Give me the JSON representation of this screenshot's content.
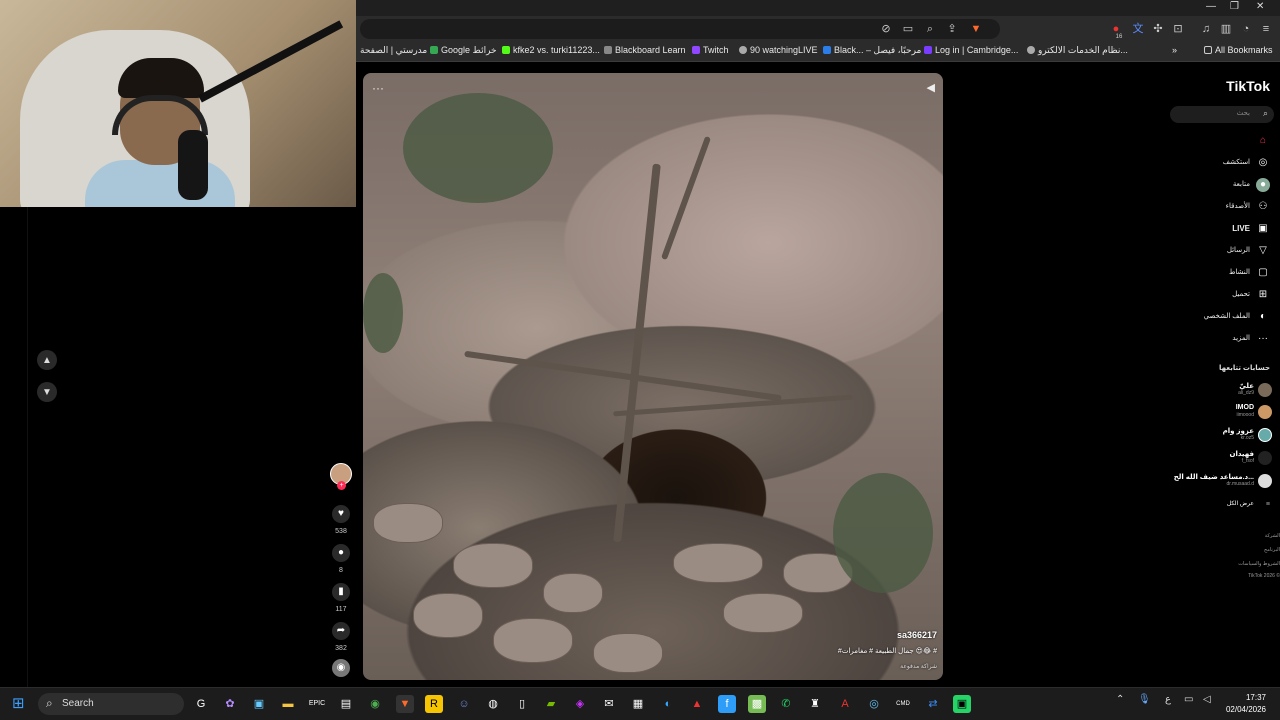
{
  "browser": {
    "bookmarks": [
      "مدرستي | الصفحة",
      "Google خرائط",
      "kfke2 vs. turki11223...",
      "Blackboard Learn",
      "Twitch",
      "90 watchingLIVE",
      "Black... – مرحبًا، فيصل",
      "Log in | Cambridge...",
      "نظام الخدمات الالكترو...",
      "All Bookmarks"
    ],
    "extension_badge": "16"
  },
  "tiktok": {
    "logo": "TikTok",
    "search_placeholder": "بحث",
    "nav": [
      {
        "label": "",
        "icon": "home-icon"
      },
      {
        "label": "استكشف",
        "icon": "compass-icon"
      },
      {
        "label": "متابعة",
        "icon": "following-icon"
      },
      {
        "label": "الأصدقاء",
        "icon": "friends-icon"
      },
      {
        "label": "LIVE",
        "icon": "live-icon"
      },
      {
        "label": "الرسائل",
        "icon": "send-icon"
      },
      {
        "label": "النشاط",
        "icon": "inbox-icon"
      },
      {
        "label": "تحميل",
        "icon": "upload-icon"
      },
      {
        "label": "الملف الشخصي",
        "icon": "profile-icon"
      },
      {
        "label": "المزيد",
        "icon": "more-icon"
      }
    ],
    "following_title": "حسابات تتابعها",
    "following": [
      {
        "name": "عليّ",
        "handle": "ali_dz9"
      },
      {
        "name": "IMOD",
        "handle": "iimoood"
      },
      {
        "name": "عزوز وام",
        "handle": "kr.oz5"
      },
      {
        "name": "فهيدان",
        "handle": "f_fsof"
      },
      {
        "name": "د.مساعد ضيف الله الح...",
        "handle": "dr.musaad.d"
      }
    ],
    "see_all": "عرض الكل",
    "footer": [
      "الشركة",
      "البرنامج",
      "الشروط والسياسات",
      "TikTok 2026 ©"
    ],
    "video": {
      "username": "sa366217",
      "caption": "#جمال الطبيعة # مغامرات 😍😂 #",
      "paid": "شراكة مدفوعة"
    },
    "actions": {
      "likes": "538",
      "comments": "8",
      "saves": "117",
      "shares": "382"
    }
  },
  "taskbar": {
    "search": "Search",
    "lang": "ع",
    "time": "17:37",
    "date": "02/04/2026"
  }
}
